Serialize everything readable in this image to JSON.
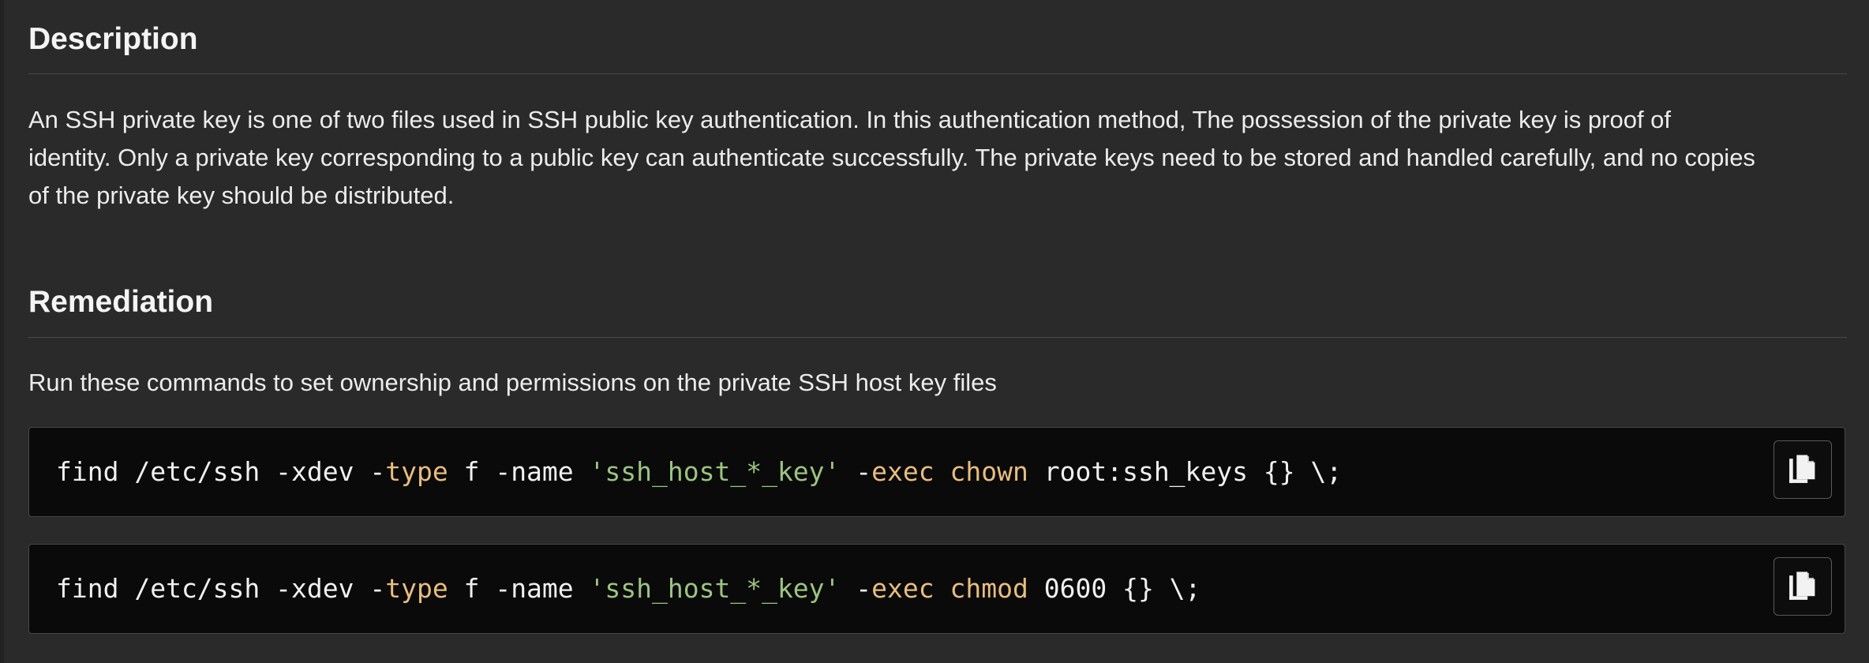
{
  "description": {
    "title": "Description",
    "lines": [
      "An SSH private key is one of two files used in SSH public key authentication. In this authentication method, The possession of the private key is proof of",
      "identity. Only a private key corresponding to a public key can authenticate successfully. The private keys need to be stored and handled carefully, and no copies",
      "of the private key should be distributed."
    ]
  },
  "remediation": {
    "title": "Remediation",
    "intro": "Run these commands to set ownership and permissions on the private SSH host key files",
    "commands": [
      {
        "tokens": [
          {
            "text": "find /etc/ssh -xdev -",
            "style": "txt"
          },
          {
            "text": "type",
            "style": "kw"
          },
          {
            "text": " f -name ",
            "style": "txt"
          },
          {
            "text": "'ssh_host_*_key'",
            "style": "str"
          },
          {
            "text": " -",
            "style": "txt"
          },
          {
            "text": "exec",
            "style": "kw"
          },
          {
            "text": " ",
            "style": "txt"
          },
          {
            "text": "chown",
            "style": "kw"
          },
          {
            "text": " root:ssh_keys {} \\;",
            "style": "txt"
          }
        ],
        "copy_icon": "copy-icon"
      },
      {
        "tokens": [
          {
            "text": "find /etc/ssh -xdev -",
            "style": "txt"
          },
          {
            "text": "type",
            "style": "kw"
          },
          {
            "text": " f -name ",
            "style": "txt"
          },
          {
            "text": "'ssh_host_*_key'",
            "style": "str"
          },
          {
            "text": " -",
            "style": "txt"
          },
          {
            "text": "exec",
            "style": "kw"
          },
          {
            "text": " ",
            "style": "txt"
          },
          {
            "text": "chmod",
            "style": "kw"
          },
          {
            "text": " 0600 {} \\;",
            "style": "txt"
          }
        ],
        "copy_icon": "copy-icon"
      }
    ]
  },
  "colors": {
    "background": "#2a2a2a",
    "code_background": "#0a0a0a",
    "keyword": "#e8bd7f",
    "string": "#9cc480"
  }
}
